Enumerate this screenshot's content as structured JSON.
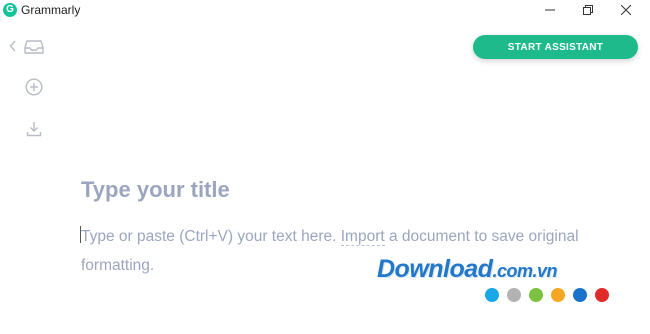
{
  "window": {
    "title": "Grammarly",
    "logo_letter": "G"
  },
  "toolbar": {
    "start_assistant_label": "START ASSISTANT"
  },
  "editor": {
    "title_placeholder": "Type your title",
    "body_text_before": "Type or paste (Ctrl+V) your text here. ",
    "import_link": "Import",
    "body_text_after": " a document to save original formatting."
  },
  "watermark": {
    "brand": "Download",
    "domain": ".com.vn",
    "dot_colors": [
      "#1aa7e8",
      "#b3b3b3",
      "#7cc242",
      "#f5a623",
      "#1a73c9",
      "#e02b2b"
    ]
  },
  "icons": {
    "sidebar": [
      "chevron-left-icon",
      "inbox-icon",
      "plus-circle-icon",
      "download-icon"
    ],
    "window_controls": [
      "minimize-icon",
      "restore-icon",
      "close-icon"
    ]
  },
  "colors": {
    "brand_green": "#1fba8c",
    "placeholder_text": "#9ba6be"
  }
}
